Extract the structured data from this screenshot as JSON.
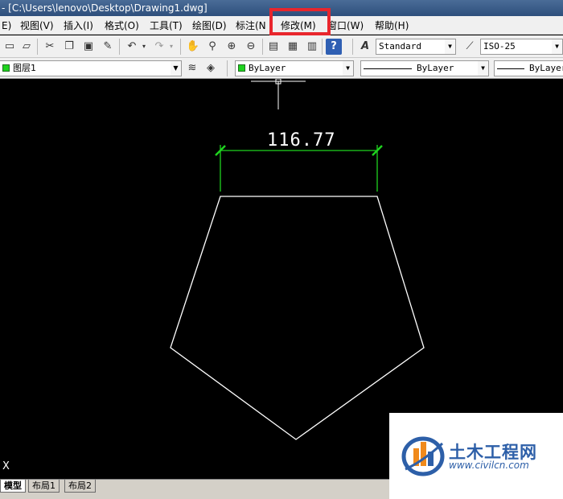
{
  "window": {
    "title": "- [C:\\Users\\lenovo\\Desktop\\Drawing1.dwg]"
  },
  "menu": {
    "items": [
      {
        "label": "E)"
      },
      {
        "label": "视图(V)"
      },
      {
        "label": "插入(I)"
      },
      {
        "label": "格式(O)"
      },
      {
        "label": "工具(T)"
      },
      {
        "label": "绘图(D)"
      },
      {
        "label": "标注(N"
      },
      {
        "label": "修改(M)"
      },
      {
        "label": "窗口(W)"
      },
      {
        "label": "帮助(H)"
      }
    ]
  },
  "toolbar": {
    "text_style": "Standard",
    "dim_style": "ISO-25"
  },
  "layers": {
    "current_layer": "图层1",
    "color": "ByLayer",
    "linetype": "ByLayer",
    "lineweight": "ByLayer"
  },
  "drawing": {
    "dimension_value": "116.77",
    "axis_label": "X"
  },
  "tabs": [
    {
      "label": "模型",
      "active": true
    },
    {
      "label": "布局1",
      "active": false
    },
    {
      "label": "布局2",
      "active": false
    }
  ],
  "watermark": {
    "title": "土木工程网",
    "url": "www.civilcn.com"
  },
  "colors": {
    "highlight": "#e8262d",
    "dimension": "#1fd31f",
    "geometry": "#ffffff",
    "background": "#000000"
  },
  "icons": [
    "new-icon",
    "open-icon",
    "cut-icon",
    "copy-icon",
    "paste-icon",
    "match-properties-icon",
    "undo-icon",
    "redo-icon",
    "pan-icon",
    "zoom-realtime-icon",
    "zoom-window-icon",
    "zoom-previous-icon",
    "properties-icon",
    "design-center-icon",
    "tool-palette-icon",
    "help-icon",
    "text-style-icon",
    "dim-style-icon",
    "layer-manager-icon",
    "layer-previous-icon"
  ]
}
